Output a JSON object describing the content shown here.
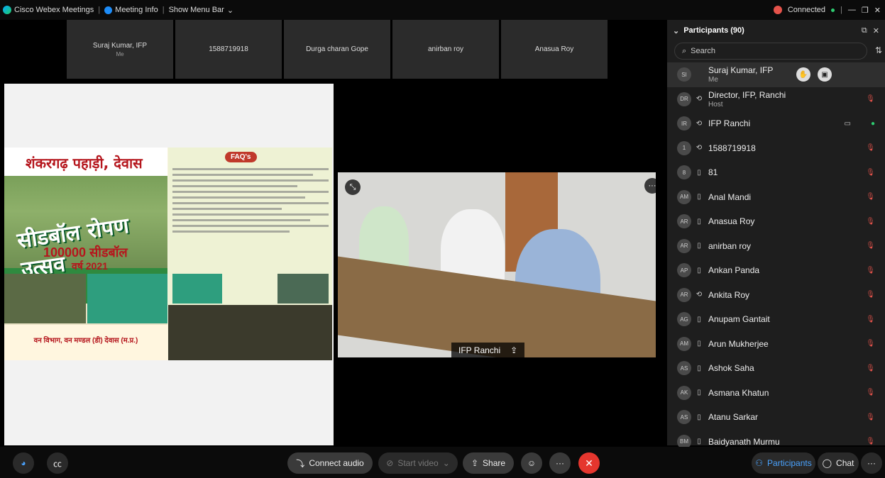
{
  "titlebar": {
    "app_name": "Cisco Webex Meetings",
    "meeting_info": "Meeting Info",
    "show_menu": "Show Menu Bar",
    "connected": "Connected"
  },
  "tiles": [
    {
      "name": "Suraj Kumar, IFP",
      "sub": "Me"
    },
    {
      "name": "1588719918",
      "sub": ""
    },
    {
      "name": "Durga charan Gope",
      "sub": ""
    },
    {
      "name": "anirban roy",
      "sub": ""
    },
    {
      "name": "Anasua Roy",
      "sub": ""
    }
  ],
  "poster": {
    "title": "शंकरगढ़ पहाड़ी, देवास",
    "headline": "सीडबॉल रोपण उत्सव",
    "count": "100000 सीडबॉल",
    "year": "वर्ष 2021",
    "faq": "FAQ's",
    "footer": "वन विभाग, वन मण्डल (डी) देवास (म.प्र.)"
  },
  "video": {
    "name": "IFP Ranchi"
  },
  "panel": {
    "title": "Participants (90)",
    "search_placeholder": "Search",
    "participants": [
      {
        "initials": "SI",
        "name": "Suraj Kumar, IFP",
        "role": "Me",
        "device": "",
        "mic": "none"
      },
      {
        "initials": "DR",
        "name": "Director, IFP, Ranchi",
        "role": "Host",
        "device": "phone",
        "mic": "muted"
      },
      {
        "initials": "IR",
        "name": "IFP Ranchi",
        "role": "",
        "device": "phone",
        "mic": "on"
      },
      {
        "initials": "1",
        "name": "1588719918",
        "role": "",
        "device": "phone",
        "mic": "muted"
      },
      {
        "initials": "8",
        "name": "81",
        "role": "",
        "device": "mobile",
        "mic": "muted"
      },
      {
        "initials": "AM",
        "name": "Anal Mandi",
        "role": "",
        "device": "mobile",
        "mic": "muted"
      },
      {
        "initials": "AR",
        "name": "Anasua Roy",
        "role": "",
        "device": "mobile",
        "mic": "muted"
      },
      {
        "initials": "AR",
        "name": "anirban roy",
        "role": "",
        "device": "mobile",
        "mic": "muted"
      },
      {
        "initials": "AP",
        "name": "Ankan Panda",
        "role": "",
        "device": "mobile",
        "mic": "muted"
      },
      {
        "initials": "AR",
        "name": "Ankita Roy",
        "role": "",
        "device": "phone",
        "mic": "muted"
      },
      {
        "initials": "AG",
        "name": "Anupam Gantait",
        "role": "",
        "device": "mobile",
        "mic": "muted"
      },
      {
        "initials": "AM",
        "name": "Arun Mukherjee",
        "role": "",
        "device": "mobile",
        "mic": "muted"
      },
      {
        "initials": "AS",
        "name": "Ashok Saha",
        "role": "",
        "device": "mobile",
        "mic": "muted"
      },
      {
        "initials": "AK",
        "name": "Asmana Khatun",
        "role": "",
        "device": "mobile",
        "mic": "muted"
      },
      {
        "initials": "AS",
        "name": "Atanu Sarkar",
        "role": "",
        "device": "mobile",
        "mic": "muted"
      },
      {
        "initials": "BM",
        "name": "Baidyanath Murmu",
        "role": "",
        "device": "mobile",
        "mic": "muted"
      }
    ]
  },
  "bottombar": {
    "connect_audio": "Connect audio",
    "start_video": "Start video",
    "share": "Share",
    "participants": "Participants",
    "chat": "Chat"
  },
  "colors": {
    "end_button": "#e5362e",
    "active_blue": "#4aa3ff",
    "muted_red": "#e5534b",
    "panel_bg": "#1e1e1e"
  }
}
